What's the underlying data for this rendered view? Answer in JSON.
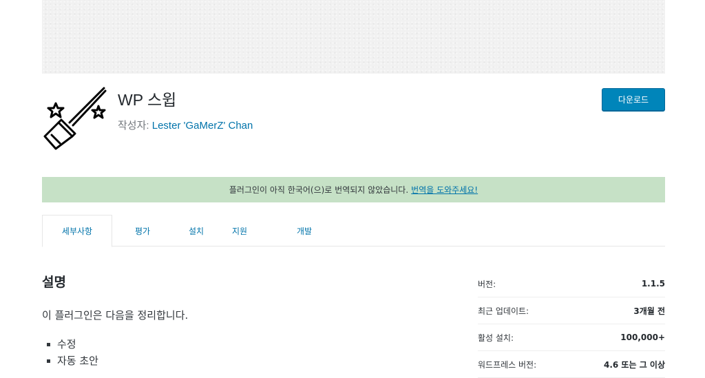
{
  "plugin": {
    "title": "WP 스윕",
    "byline_prefix": "작성자: ",
    "author": "Lester 'GaMerZ' Chan",
    "download_label": "다운로드",
    "icon": "broom-with-stars-icon"
  },
  "notice": {
    "text": "플러그인이 아직 한국어(으)로 번역되지 않았습니다.",
    "link": "번역을 도와주세요!"
  },
  "tabs": [
    {
      "label": "세부사항",
      "active": true
    },
    {
      "label": "평가"
    },
    {
      "label": "설치"
    },
    {
      "label": "지원"
    },
    {
      "label": "개발"
    }
  ],
  "description": {
    "heading": "설명",
    "intro": "이 플러그인은 다음을 정리합니다.",
    "items": [
      "수정",
      "자동 초안"
    ]
  },
  "meta": [
    {
      "key": "버전:",
      "value": "1.1.5"
    },
    {
      "key": "최근 업데이트:",
      "value": "3개월 전"
    },
    {
      "key": "활성 설치:",
      "value": "100,000+"
    },
    {
      "key": "워드프레스 버전:",
      "value": "4.6 또는 그 이상"
    }
  ],
  "colors": {
    "accent": "#0085ba",
    "link": "#0073aa",
    "notice_bg": "#c6e1c6",
    "banner_bg": "#f1f1f1"
  }
}
